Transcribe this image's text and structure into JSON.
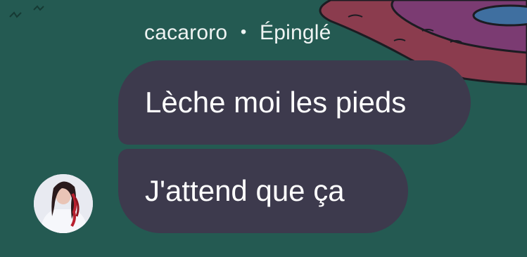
{
  "chat": {
    "sender": "cacaroro",
    "separator": "•",
    "pinned_label": "Épinglé",
    "messages": [
      {
        "text": "Lèche moi les pieds"
      },
      {
        "text": "J'attend que ça"
      }
    ]
  },
  "colors": {
    "background": "#245a52",
    "bubble": "#3d3a4d",
    "text": "#ffffff",
    "sender_text": "#eef3f2"
  }
}
